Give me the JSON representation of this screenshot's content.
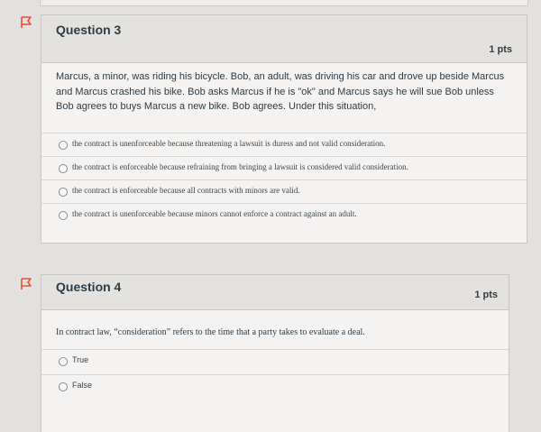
{
  "question3": {
    "title": "Question 3",
    "points": "1 pts",
    "text": "Marcus, a minor, was riding his bicycle.  Bob, an adult, was driving his car and drove up beside Marcus and Marcus crashed his bike.  Bob asks Marcus if he is \"ok\" and Marcus says he will sue Bob unless Bob agrees to buys Marcus a new bike.  Bob agrees.  Under this situation,",
    "answers": [
      "the contract is unenforceable because threatening a lawsuit is duress and not valid consideration.",
      "the contract is enforceable because refraining from bringing a lawsuit is considered valid consideration.",
      "the contract is enforceable because all contracts with minors are valid.",
      "the contract is unenforceable because minors cannot enforce a contract against an adult."
    ]
  },
  "question4": {
    "title": "Question 4",
    "points": "1 pts",
    "text": "In contract law, “consideration” refers to the time that a party takes to evaluate a deal.",
    "answers": [
      "True",
      "False"
    ]
  },
  "colors": {
    "flag": "#e6502d",
    "header_bg": "#e4e2df",
    "card_bg": "#f4f3f1"
  },
  "icons": {
    "flag": "flag-icon"
  }
}
